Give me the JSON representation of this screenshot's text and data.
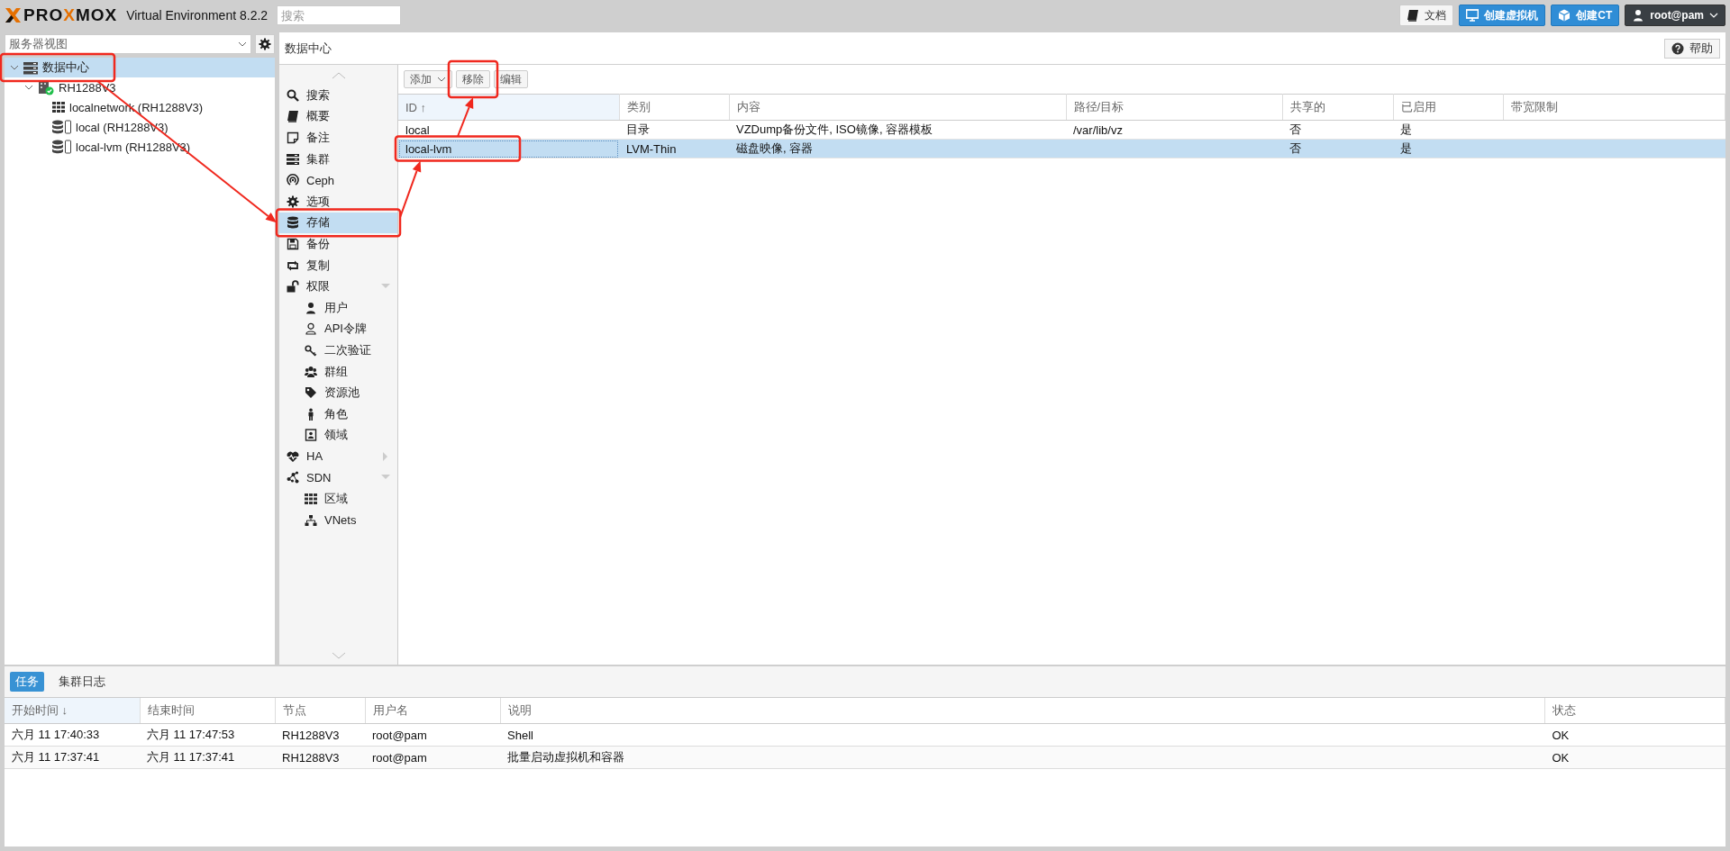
{
  "header": {
    "logo_parts": [
      {
        "text": "PRO",
        "accent": false
      },
      {
        "text": "X",
        "accent": true
      },
      {
        "text": "MOX",
        "accent": false
      }
    ],
    "version": "Virtual Environment 8.2.2",
    "search": {
      "placeholder": "搜索"
    },
    "buttons": [
      {
        "label": "文档",
        "kind": "plain"
      },
      {
        "label": "创建虚拟机",
        "kind": "primary"
      },
      {
        "label": "创建CT",
        "kind": "primary"
      },
      {
        "label": "root@pam",
        "kind": "user"
      }
    ]
  },
  "sidebar": {
    "view_select": {
      "value": "服务器视图"
    },
    "tree": [
      {
        "label": "数据中心",
        "selected": true,
        "expanded": true,
        "callout": true,
        "children": [
          {
            "label": "RH1288V3",
            "selected": false,
            "expanded": true,
            "callout": false,
            "children": [
              {
                "label": "localnetwork (RH1288V3)",
                "selected": false,
                "callout": false
              },
              {
                "label": "local (RH1288V3)",
                "selected": false,
                "callout": false
              },
              {
                "label": "local-lvm (RH1288V3)",
                "selected": false,
                "callout": false
              }
            ]
          }
        ]
      }
    ]
  },
  "content": {
    "title": "数据中心",
    "help_button": "帮助",
    "menu": [
      {
        "label": "搜索",
        "selected": false,
        "callout": false
      },
      {
        "label": "概要",
        "selected": false,
        "callout": false
      },
      {
        "label": "备注",
        "selected": false,
        "callout": false
      },
      {
        "label": "集群",
        "selected": false,
        "callout": false
      },
      {
        "label": "Ceph",
        "selected": false,
        "callout": false
      },
      {
        "label": "选项",
        "selected": false,
        "callout": false
      },
      {
        "label": "存储",
        "selected": true,
        "callout": true
      },
      {
        "label": "备份",
        "selected": false,
        "callout": false
      },
      {
        "label": "复制",
        "selected": false,
        "callout": false
      },
      {
        "label": "权限",
        "selected": false,
        "callout": false,
        "expanded": true,
        "children": [
          {
            "label": "用户",
            "selected": false,
            "callout": false
          },
          {
            "label": "API令牌",
            "selected": false,
            "callout": false
          },
          {
            "label": "二次验证",
            "selected": false,
            "callout": false
          },
          {
            "label": "群组",
            "selected": false,
            "callout": false
          },
          {
            "label": "资源池",
            "selected": false,
            "callout": false
          },
          {
            "label": "角色",
            "selected": false,
            "callout": false
          },
          {
            "label": "领域",
            "selected": false,
            "callout": false
          }
        ]
      },
      {
        "label": "HA",
        "selected": false,
        "callout": false,
        "expanded": false
      },
      {
        "label": "SDN",
        "selected": false,
        "callout": false,
        "expanded": true,
        "children": [
          {
            "label": "区域",
            "selected": false,
            "callout": false
          },
          {
            "label": "VNets",
            "selected": false,
            "callout": false
          }
        ]
      }
    ],
    "toolbar": [
      {
        "label": "添加",
        "kind": "dropdown",
        "callout": false
      },
      {
        "label": "移除",
        "kind": "button",
        "callout": true
      },
      {
        "label": "编辑",
        "kind": "button",
        "callout": false
      }
    ],
    "table": {
      "columns": [
        {
          "label": "ID",
          "sort_indicator": "↑"
        },
        {
          "label": "类别"
        },
        {
          "label": "内容"
        },
        {
          "label": "路径/目标"
        },
        {
          "label": "共享的"
        },
        {
          "label": "已启用"
        },
        {
          "label": "带宽限制"
        }
      ],
      "rows": [
        {
          "selected": false,
          "callout": false,
          "cells": [
            "local",
            "目录",
            "VZDump备份文件, ISO镜像, 容器模板",
            "/var/lib/vz",
            "否",
            "是"
          ]
        },
        {
          "selected": true,
          "callout": true,
          "cells": [
            "local-lvm",
            "LVM-Thin",
            "磁盘映像, 容器",
            "",
            "否",
            "是"
          ]
        }
      ]
    }
  },
  "bottom_panel": {
    "tabs": [
      {
        "label": "任务",
        "selected": true
      },
      {
        "label": "集群日志",
        "selected": false
      }
    ],
    "table": {
      "columns": [
        {
          "label": "开始时间",
          "sort_indicator": "↓"
        },
        {
          "label": "结束时间"
        },
        {
          "label": "节点"
        },
        {
          "label": "用户名"
        },
        {
          "label": "说明"
        },
        {
          "label": "状态"
        }
      ],
      "rows": [
        {
          "cells": [
            "六月 11 17:40:33",
            "六月 11 17:47:53",
            "RH1288V3",
            "root@pam",
            "Shell",
            "OK"
          ]
        },
        {
          "cells": [
            "六月 11 17:37:41",
            "六月 11 17:37:41",
            "RH1288V3",
            "root@pam",
            "批量启动虚拟机和容器",
            "OK"
          ]
        }
      ]
    }
  }
}
